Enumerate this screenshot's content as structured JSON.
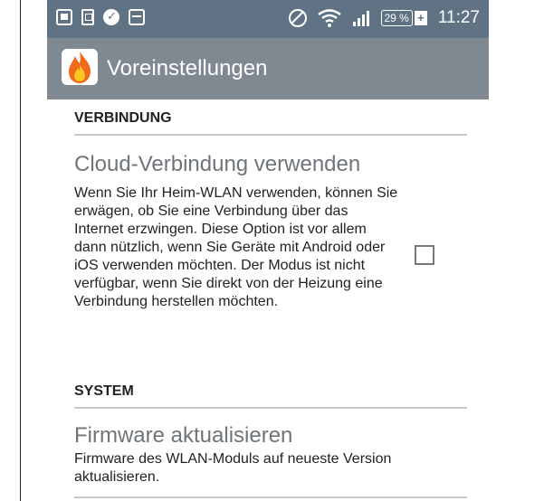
{
  "status_bar": {
    "time": "11:27",
    "battery": "29 %",
    "battery_charging": "+",
    "icons": [
      "image-icon",
      "phone-icon",
      "check-circle-icon",
      "calendar-icon",
      "do-not-disturb-icon",
      "wifi-icon",
      "signal-icon",
      "battery-icon"
    ]
  },
  "action_bar": {
    "title": "Voreinstellungen",
    "icon": "flame-app-icon"
  },
  "sections": [
    {
      "header": "VERBINDUNG",
      "preference": {
        "title": "Cloud-Verbindung verwenden",
        "summary": "Wenn Sie Ihr Heim-WLAN verwenden, können Sie erwägen, ob Sie eine Verbindung über das Internet erzwingen. Diese Option ist vor allem dann nützlich, wenn Sie Geräte mit Android oder iOS verwenden möchten. Der Modus ist nicht verfügbar, wenn Sie direkt von der Heizung eine Verbindung herstellen möchten.",
        "checked": false
      }
    },
    {
      "header": "SYSTEM",
      "preference": {
        "title": "Firmware aktualisieren",
        "summary": "Firmware des WLAN-Moduls auf neueste Version aktualisieren."
      }
    }
  ],
  "colors": {
    "status_bar": "#5f7385",
    "action_bar": "#808891",
    "pref_title": "#6f7479",
    "divider": "#c9c9c9"
  }
}
